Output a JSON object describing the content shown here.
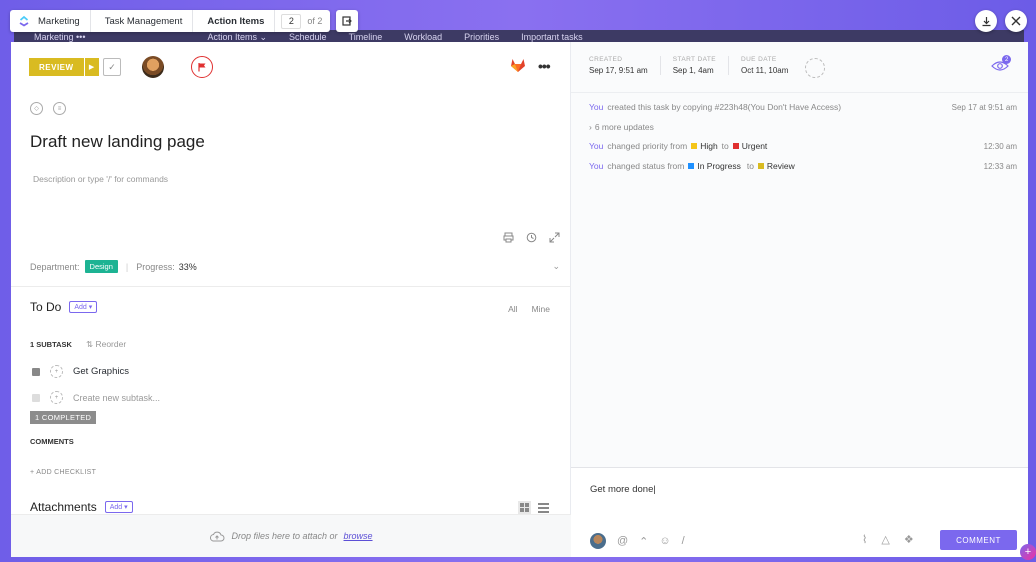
{
  "breadcrumb": {
    "items": [
      "Marketing",
      "Task Management",
      "Action Items"
    ],
    "page_current": "2",
    "page_total": "of 2"
  },
  "background_tabs": [
    "Marketing •••",
    "Action Items ⌄",
    "Schedule",
    "Timeline",
    "Workload",
    "Priorities",
    "Important tasks"
  ],
  "task": {
    "status": "REVIEW",
    "title": "Draft new landing page",
    "description_placeholder": "Description or type '/' for commands",
    "department_label": "Department:",
    "department_value": "Design",
    "progress_label": "Progress:",
    "progress_value": "33%"
  },
  "todo": {
    "heading": "To Do",
    "add_label": "Add",
    "filter_all": "All",
    "filter_mine": "Mine",
    "subtask_count": "1 SUBTASK",
    "reorder": "Reorder",
    "subtasks": [
      "Get Graphics"
    ],
    "new_subtask_placeholder": "Create new subtask...",
    "completed_badge": "1 COMPLETED",
    "comments_heading": "COMMENTS",
    "add_checklist": "+ ADD CHECKLIST"
  },
  "attachments": {
    "heading": "Attachments",
    "add_label": "Add",
    "drop_text": "Drop files here to attach or",
    "browse": "browse"
  },
  "meta": {
    "created_label": "CREATED",
    "created_value": "Sep 17, 9:51 am",
    "start_label": "START DATE",
    "start_value": "Sep 1, 4am",
    "due_label": "DUE DATE",
    "due_value": "Oct 11, 10am",
    "watchers": "2"
  },
  "activity": [
    {
      "you": "You",
      "text": "created this task by copying  #223h48(You Don't Have Access)",
      "time": "Sep 17 at 9:51 am"
    },
    {
      "text": "6 more updates"
    },
    {
      "you": "You",
      "text": "changed priority from",
      "from": "High",
      "to_word": "to",
      "to": "Urgent",
      "time": "12:30 am"
    },
    {
      "you": "You",
      "text": "changed status from",
      "from": "In Progress",
      "to_word": "to",
      "to": "Review",
      "time": "12:33 am"
    }
  ],
  "composer": {
    "text": "Get more done|",
    "button": "COMMENT"
  },
  "colors": {
    "accent": "#7b68ee",
    "review": "#d9bb21",
    "design": "#1db393",
    "urgent": "#e03030",
    "high": "#f5c518",
    "inprogress": "#1e90ff"
  }
}
